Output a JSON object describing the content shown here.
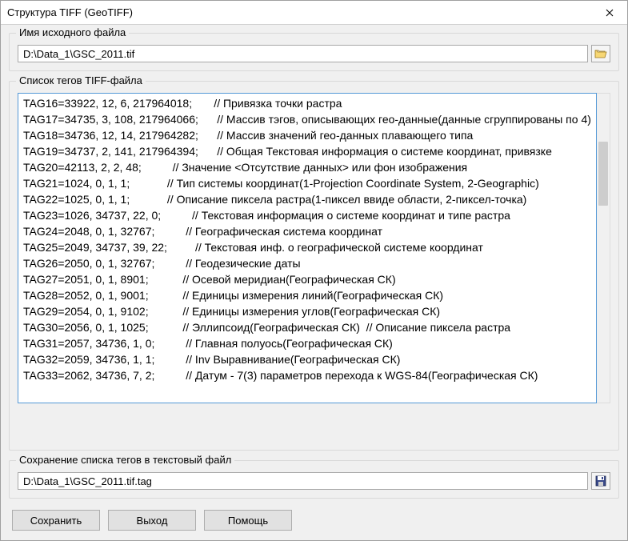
{
  "window": {
    "title": "Структура TIFF (GeoTIFF)"
  },
  "source": {
    "legend": "Имя исходного файла",
    "path": "D:\\Data_1\\GSC_2011.tif"
  },
  "tags": {
    "legend": "Список тегов TIFF-файла",
    "rows": [
      "TAG16=33922, 12, 6, 217964018;       // Привязка точки растра",
      "TAG17=34735, 3, 108, 217964066;      // Массив тэгов, описывающих гео-данные(данные сгруппированы по 4)",
      "TAG18=34736, 12, 14, 217964282;      // Массив значений гео-данных плавающего типа",
      "TAG19=34737, 2, 141, 217964394;      // Общая Текстовая информация о системе координат, привязке",
      "TAG20=42113, 2, 2, 48;          // Значение <Отсутствие данных> или фон изображения",
      "TAG21=1024, 0, 1, 1;            // Тип системы координат(1-Projection Coordinate System, 2-Geographic)",
      "TAG22=1025, 0, 1, 1;            // Описание пиксела растра(1-пиксел ввиде области, 2-пиксел-точка)",
      "TAG23=1026, 34737, 22, 0;          // Текстовая информация о системе координат и типе растра",
      "TAG24=2048, 0, 1, 32767;          // Географическая система координат",
      "TAG25=2049, 34737, 39, 22;         // Текстовая инф. о географической системе координат",
      "TAG26=2050, 0, 1, 32767;          // Геодезические даты",
      "TAG27=2051, 0, 1, 8901;           // Осевой меридиан(Географическая СК)",
      "TAG28=2052, 0, 1, 9001;           // Единицы измерения линий(Географическая СК)",
      "TAG29=2054, 0, 1, 9102;           // Единицы измерения углов(Географическая СК)",
      "TAG30=2056, 0, 1, 1025;           // Эллипсоид(Географическая СК)  // Описание пиксела растра",
      "TAG31=2057, 34736, 1, 0;          // Главная полуось(Географическая СК)",
      "TAG32=2059, 34736, 1, 1;          // Inv Выравнивание(Географическая СК)",
      "TAG33=2062, 34736, 7, 2;          // Датум - 7(3) параметров перехода к WGS-84(Географическая СК)"
    ]
  },
  "save": {
    "legend": "Сохранение списка тегов в текстовый файл",
    "path": "D:\\Data_1\\GSC_2011.tif.tag"
  },
  "buttons": {
    "save": "Сохранить",
    "exit": "Выход",
    "help": "Помощь"
  },
  "icons": {
    "open": "folder-open-icon",
    "save": "save-icon",
    "close": "close-icon"
  }
}
